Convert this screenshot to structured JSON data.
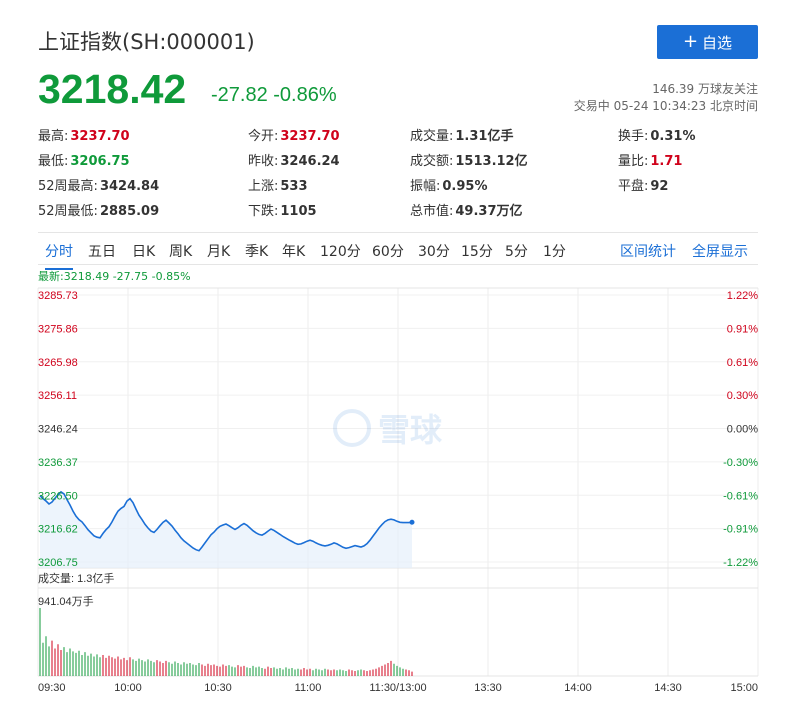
{
  "header": {
    "title": "上证指数(SH:000001)",
    "follow_button": "自选",
    "price": "3218.42",
    "change": "-27.82 -0.86%",
    "follows": "146.39 万球友关注",
    "status": "交易中 05-24 10:34:23 北京时间"
  },
  "stats": [
    {
      "label": "最高:",
      "value": "3237.70",
      "color": "red"
    },
    {
      "label": "今开:",
      "value": "3237.70",
      "color": "red"
    },
    {
      "label": "成交量:",
      "value": "1.31亿手",
      "color": ""
    },
    {
      "label": "换手:",
      "value": "0.31%",
      "color": ""
    },
    {
      "label": "最低:",
      "value": "3206.75",
      "color": "green"
    },
    {
      "label": "昨收:",
      "value": "3246.24",
      "color": ""
    },
    {
      "label": "成交额:",
      "value": "1513.12亿",
      "color": ""
    },
    {
      "label": "量比:",
      "value": "1.71",
      "color": "red"
    },
    {
      "label": "52周最高:",
      "value": "3424.84",
      "color": ""
    },
    {
      "label": "上涨:",
      "value": "533",
      "color": ""
    },
    {
      "label": "振幅:",
      "value": "0.95%",
      "color": ""
    },
    {
      "label": "平盘:",
      "value": "92",
      "color": ""
    },
    {
      "label": "52周最低:",
      "value": "2885.09",
      "color": ""
    },
    {
      "label": "下跌:",
      "value": "1105",
      "color": ""
    },
    {
      "label": "总市值:",
      "value": "49.37万亿",
      "color": ""
    }
  ],
  "tabs": [
    "分时",
    "五日",
    "日K",
    "周K",
    "月K",
    "季K",
    "年K",
    "120分",
    "60分",
    "30分",
    "15分",
    "5分",
    "1分"
  ],
  "tabs_right": [
    "区间统计",
    "全屏显示"
  ],
  "latest": "最新:3218.49 -27.75 -0.85%",
  "watermark": "雪球",
  "colors": {
    "up": "#d0021b",
    "down": "#0f9a3a",
    "accent": "#1b6fd6",
    "line": "#1b6fd6"
  },
  "chart_data": {
    "type": "line",
    "price_levels": [
      "3285.73",
      "3275.86",
      "3265.98",
      "3256.11",
      "3246.24",
      "3236.37",
      "3226.50",
      "3216.62",
      "3206.75"
    ],
    "pct_levels": [
      "1.22%",
      "0.91%",
      "0.61%",
      "0.30%",
      "0.00%",
      "-0.30%",
      "-0.61%",
      "-0.91%",
      "-1.22%"
    ],
    "volume_label": "成交量: 1.3亿手",
    "volume_max_label": "941.04万手",
    "x_labels": [
      "09:30",
      "10:00",
      "10:30",
      "11:00",
      "11:30/13:00",
      "13:30",
      "14:00",
      "14:30",
      "15:00"
    ],
    "ylim": [
      3206.75,
      3285.73
    ],
    "series": [
      {
        "values": [
          3226.4,
          3225.5,
          3224.8,
          3223.9,
          3224.5,
          3225.6,
          3226.7,
          3227.5,
          3226.9,
          3225.2,
          3223.6,
          3221.8,
          3220.3,
          3219.3,
          3218.6,
          3217.5,
          3216.3,
          3215.4,
          3214.5,
          3214.1,
          3213.9,
          3215.2,
          3216.3,
          3217.2,
          3218.6,
          3220.3,
          3221.8,
          3222.6,
          3223.2,
          3224.8,
          3225.5,
          3224.3,
          3222.4,
          3220.6,
          3219.3,
          3217.9,
          3216.8,
          3215.9,
          3215.5,
          3216.4,
          3217.5,
          3218.5,
          3219.1,
          3218.3,
          3217.4,
          3216.2,
          3215.1,
          3213.9,
          3213.0,
          3212.3,
          3211.6,
          3210.9,
          3210.4,
          3210.1,
          3211.2,
          3212.4,
          3213.6,
          3214.8,
          3215.6,
          3216.6,
          3217.3,
          3217.7,
          3218.0,
          3217.5,
          3216.9,
          3216.4,
          3216.9,
          3217.6,
          3218.1,
          3217.6,
          3216.8,
          3216.0,
          3215.4,
          3214.9,
          3214.7,
          3215.2,
          3215.9,
          3216.5,
          3216.1,
          3215.5,
          3214.9,
          3214.3,
          3213.8,
          3213.3,
          3212.8,
          3212.3,
          3212.0,
          3212.1,
          3212.5,
          3212.9,
          3213.2,
          3212.9,
          3212.4,
          3212.0,
          3211.7,
          3211.5,
          3211.7,
          3212.0,
          3212.4,
          3212.1,
          3211.6,
          3211.1,
          3210.8,
          3211.0,
          3211.3,
          3211.6,
          3211.4,
          3211.2,
          3211.5,
          3212.2,
          3213.2,
          3214.4,
          3215.6,
          3216.8,
          3217.8,
          3218.7,
          3219.2,
          3219.4,
          3219.2,
          3218.8,
          3218.5,
          3218.4,
          3218.4,
          3218.4,
          3218.5
        ]
      }
    ],
    "volume": [
      9.41,
      4.6,
      5.5,
      4.1,
      4.9,
      3.8,
      4.4,
      3.6,
      4.0,
      3.3,
      3.8,
      3.4,
      3.2,
      3.5,
      2.9,
      3.3,
      2.8,
      3.1,
      2.7,
      3.0,
      2.6,
      2.9,
      2.5,
      2.8,
      2.6,
      2.4,
      2.7,
      2.3,
      2.5,
      2.2,
      2.6,
      2.3,
      2.1,
      2.4,
      2.2,
      2.0,
      2.3,
      2.1,
      1.9,
      2.2,
      2.0,
      1.8,
      2.1,
      1.9,
      1.7,
      2.0,
      1.8,
      1.6,
      1.9,
      1.7,
      1.8,
      1.6,
      1.5,
      1.8,
      1.6,
      1.4,
      1.7,
      1.5,
      1.6,
      1.4,
      1.3,
      1.6,
      1.4,
      1.5,
      1.3,
      1.2,
      1.5,
      1.3,
      1.4,
      1.2,
      1.1,
      1.4,
      1.2,
      1.3,
      1.1,
      1.0,
      1.3,
      1.1,
      1.2,
      1.0,
      1.1,
      0.9,
      1.2,
      1.0,
      1.1,
      0.9,
      1.0,
      0.9,
      1.1,
      0.9,
      1.0,
      0.8,
      1.0,
      0.9,
      0.8,
      1.0,
      0.9,
      0.8,
      0.9,
      0.8,
      0.9,
      0.8,
      0.7,
      0.9,
      0.8,
      0.7,
      0.8,
      0.9,
      0.8,
      0.7,
      0.8,
      0.9,
      1.0,
      1.2,
      1.4,
      1.6,
      1.8,
      2.1,
      1.7,
      1.4,
      1.2,
      1.0,
      0.9,
      0.8,
      0.6
    ]
  }
}
